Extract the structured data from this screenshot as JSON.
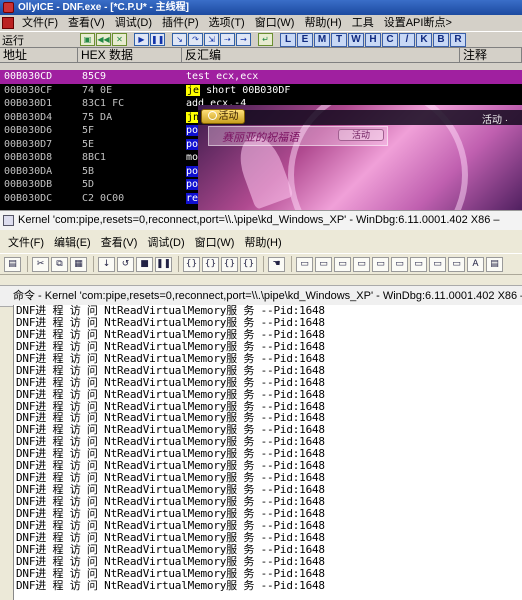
{
  "olly": {
    "title": "OllyICE - DNF.exe - [*C.P.U* - 主线程]",
    "menu": [
      "文件(F)",
      "查看(V)",
      "调试(D)",
      "插件(P)",
      "选项(T)",
      "窗口(W)",
      "帮助(H)",
      "工具",
      "设置API断点>"
    ],
    "toolbar_label": "运行",
    "letters": [
      "L",
      "E",
      "M",
      "T",
      "W",
      "H",
      "C",
      "/",
      "K",
      "B",
      "R"
    ],
    "columns": [
      "地址",
      "HEX 数据",
      "反汇编",
      "注释"
    ],
    "rows": [
      {
        "addr": "00B030CD",
        "hex": "85C9",
        "mn": "test",
        "ops": "ecx,ecx",
        "style": "sel"
      },
      {
        "addr": "00B030CF",
        "hex": "74 0E",
        "mn": "je",
        "ops": "short 00B030DF",
        "style": "jmp"
      },
      {
        "addr": "00B030D1",
        "hex": "83C1 FC",
        "mn": "add",
        "ops": "ecx,-4",
        "style": "plain"
      },
      {
        "addr": "00B030D4",
        "hex": "75 DA",
        "mn": "jnz",
        "ops": "",
        "style": "jmp"
      },
      {
        "addr": "00B030D6",
        "hex": "5F",
        "mn": "pop",
        "ops": "",
        "style": "blue"
      },
      {
        "addr": "00B030D7",
        "hex": "5E",
        "mn": "pop",
        "ops": "",
        "style": "blue"
      },
      {
        "addr": "00B030D8",
        "hex": "8BC1",
        "mn": "mov",
        "ops": "",
        "style": "plain"
      },
      {
        "addr": "00B030DA",
        "hex": "5B",
        "mn": "pop",
        "ops": "",
        "style": "blue"
      },
      {
        "addr": "00B030DB",
        "hex": "5D",
        "mn": "pop",
        "ops": "",
        "style": "blue"
      },
      {
        "addr": "00B030DC",
        "hex": "C2 0C00",
        "mn": "retn",
        "ops": "",
        "style": "blue"
      }
    ]
  },
  "game": {
    "button": "活动",
    "activity": "活动 ·",
    "panel_title": "赛丽亚的祝福语",
    "panel_button": "活动"
  },
  "windbg": {
    "title": "Kernel 'com:pipe,resets=0,reconnect,port=\\\\.\\pipe\\kd_Windows_XP' - WinDbg:6.11.0001.402 X86 –",
    "menu": [
      "文件(F)",
      "编辑(E)",
      "查看(V)",
      "调试(D)",
      "窗口(W)",
      "帮助(H)"
    ],
    "cmd_bar": "命令 - Kernel 'com:pipe,resets=0,reconnect,port=\\\\.\\pipe\\kd_Windows_XP' - WinDbg:6.11.0001.402 X86 –",
    "output_line": "DNF进 程 访 问 NtReadVirtualMemory服 务 --Pid:1648",
    "output_count": 24
  }
}
